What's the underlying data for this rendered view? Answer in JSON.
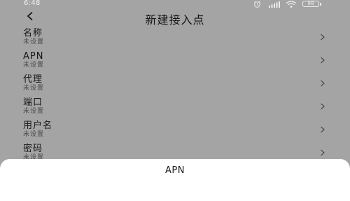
{
  "status_bar": {
    "time": "6:48",
    "battery": "88"
  },
  "header": {
    "title": "新建接入点"
  },
  "rows": [
    {
      "label": "名称",
      "value": "未设置"
    },
    {
      "label": "APN",
      "value": "未设置"
    },
    {
      "label": "代理",
      "value": "未设置"
    },
    {
      "label": "端口",
      "value": "未设置"
    },
    {
      "label": "用户名",
      "value": "未设置"
    },
    {
      "label": "密码",
      "value": "未设置"
    }
  ],
  "sheet": {
    "title": "APN"
  },
  "colors": {
    "dim_background": "#a4a4a4",
    "sheet_background": "#ffffff",
    "text_primary": "#161616"
  },
  "icons": {
    "back": "chevron-left-icon",
    "row_arrow": "chevron-right-icon",
    "alarm": "alarm-icon",
    "signal": "signal-icon",
    "wifi": "wifi-icon",
    "battery": "battery-icon"
  }
}
